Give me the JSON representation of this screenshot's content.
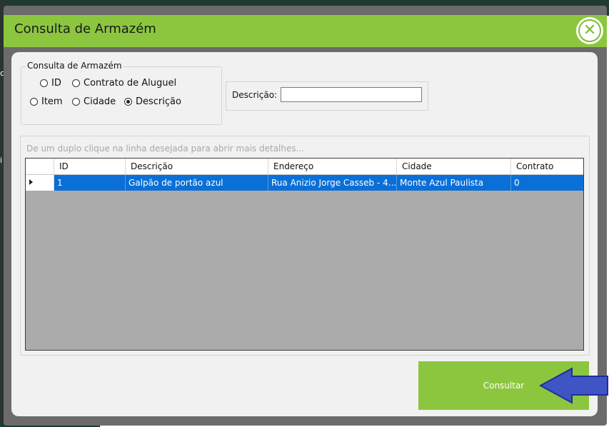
{
  "window": {
    "title": "Consulta de Armazém"
  },
  "search_group": {
    "legend": "Consulta de Armazém",
    "options": [
      {
        "label": "ID",
        "selected": false
      },
      {
        "label": "Contrato de Aluguel",
        "selected": false
      },
      {
        "label": "Item",
        "selected": false
      },
      {
        "label": "Cidade",
        "selected": false
      },
      {
        "label": "Descrição",
        "selected": true
      }
    ]
  },
  "description_field": {
    "label": "Descrição:",
    "value": ""
  },
  "results": {
    "hint": "De um duplo clique na linha desejada para abrir mais detalhes...",
    "columns": [
      "ID",
      "Descrição",
      "Endereço",
      "Cidade",
      "Contrato"
    ],
    "rows": [
      [
        "1",
        "Galpão de portão azul",
        "Rua Anizio Jorge Casseb - 4...",
        "Monte Azul Paulista",
        "0"
      ]
    ]
  },
  "consult_button": {
    "label": "Consultar"
  },
  "colors": {
    "accent_green": "#8cc63f",
    "selection_blue": "#0a6fd6",
    "arrow_blue": "#3f55c6"
  },
  "icons": {
    "close": "close-icon",
    "row_indicator": "row-pointer-icon",
    "annotation": "blue-arrow-icon"
  }
}
